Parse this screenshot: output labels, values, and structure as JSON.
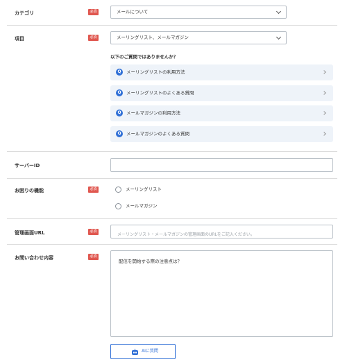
{
  "badge_required": "必須",
  "fields": {
    "category": {
      "label": "カテゴリ",
      "value": "メールについて"
    },
    "item": {
      "label": "項目",
      "value": "メーリングリスト、メールマガジン"
    },
    "server_id": {
      "label": "サーバーID",
      "value": ""
    },
    "feature": {
      "label": "お困りの機能",
      "options": [
        "メーリングリスト",
        "メールマガジン"
      ]
    },
    "admin_url": {
      "label": "管理画面URL",
      "placeholder": "メーリングリスト・メールマガジンの管理画面のURLをご記入ください。"
    },
    "inquiry": {
      "label": "お問い合わせ内容",
      "value": "配信を開始する際の注意点は？"
    }
  },
  "suggestions": {
    "title": "以下のご質問ではありませんか？",
    "items": [
      "メーリングリストの利用方法",
      "メーリングリストのよくある質問",
      "メールマガジンの利用方法",
      "メールマガジンのよくある質問"
    ]
  },
  "ai_button": {
    "label": "AIに質問"
  },
  "colors": {
    "accent": "#2f6fd6",
    "required_badge": "#e0574f",
    "suggest_bg": "#eef3f9"
  }
}
